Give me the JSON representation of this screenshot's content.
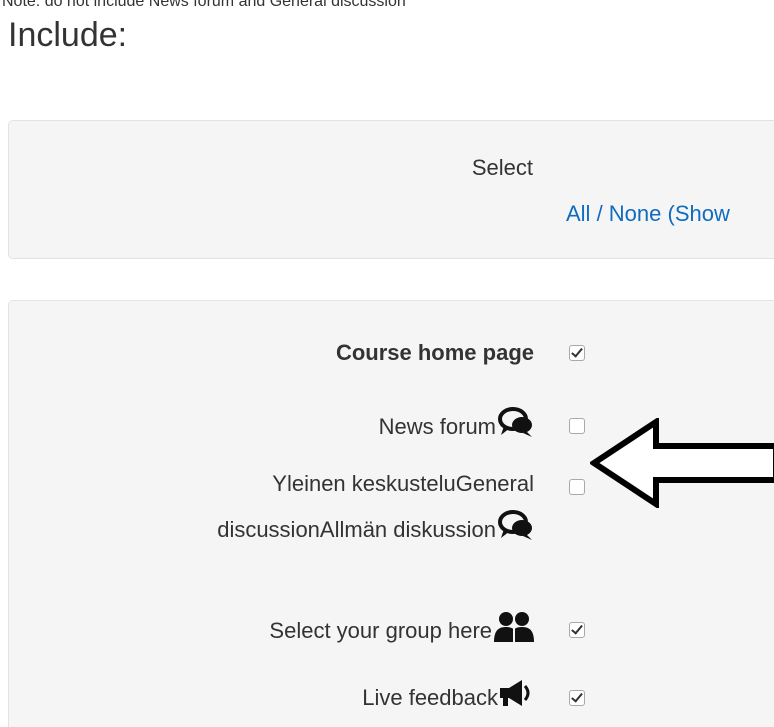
{
  "note": "Note: do not include News forum and General discussion",
  "heading": "Include:",
  "select_panel": {
    "label": "Select",
    "link_all": "All",
    "link_sep": " / ",
    "link_none": "None",
    "link_show": " (Show"
  },
  "items": [
    {
      "label": "Course home page",
      "bold": true,
      "icon": "",
      "checked": true
    },
    {
      "label": "News forum",
      "bold": false,
      "icon": "forum-icon",
      "checked": false
    },
    {
      "label_line1": "Yleinen keskusteluGeneral",
      "label_line2": "discussionAllmän diskussion",
      "bold": false,
      "icon": "forum-icon",
      "checked": false
    },
    {
      "label": "Select your group here",
      "bold": false,
      "icon": "group-icon",
      "checked": true
    },
    {
      "label": "Live feedback",
      "bold": false,
      "icon": "megaphone-icon",
      "checked": true
    }
  ],
  "colors": {
    "link": "#0f6cbf",
    "panel_bg": "#f5f5f5",
    "text": "#333333"
  }
}
